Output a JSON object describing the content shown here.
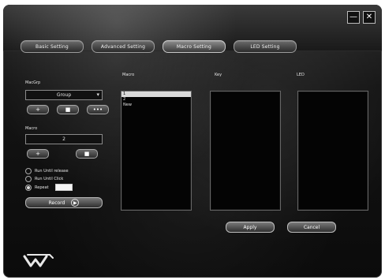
{
  "window": {
    "minimize_label": "—",
    "close_label": "✕"
  },
  "tabs": [
    {
      "label": "Basic Setting",
      "active": false
    },
    {
      "label": "Advanced Setting",
      "active": false
    },
    {
      "label": "Macro Setting",
      "active": true
    },
    {
      "label": "LED Setting",
      "active": false
    }
  ],
  "left": {
    "macrogroup_label": "MacGrp",
    "group_value": "Group",
    "group_buttons": [
      "+",
      "■",
      "•••"
    ],
    "macro_label": "Macro",
    "macro_value": "2",
    "macro_buttons": [
      "+",
      "■"
    ],
    "radios": [
      {
        "label": "Run Until release",
        "checked": false
      },
      {
        "label": "Run Until Click",
        "checked": false
      },
      {
        "label": "Repeat",
        "checked": true
      }
    ],
    "repeat_value": "",
    "record_label": "Record"
  },
  "panels": {
    "macro_title": "Macro",
    "key_title": "Key",
    "led_title": "LED",
    "macro_items": [
      "1",
      "2",
      "New"
    ]
  },
  "bottom": {
    "apply_label": "Apply",
    "cancel_label": "Cancel"
  },
  "icons": {
    "minimize": "minimize-icon",
    "close": "close-icon",
    "record": "record-icon",
    "logo": "logo-icon",
    "dropdown": "chevron-down-icon"
  }
}
